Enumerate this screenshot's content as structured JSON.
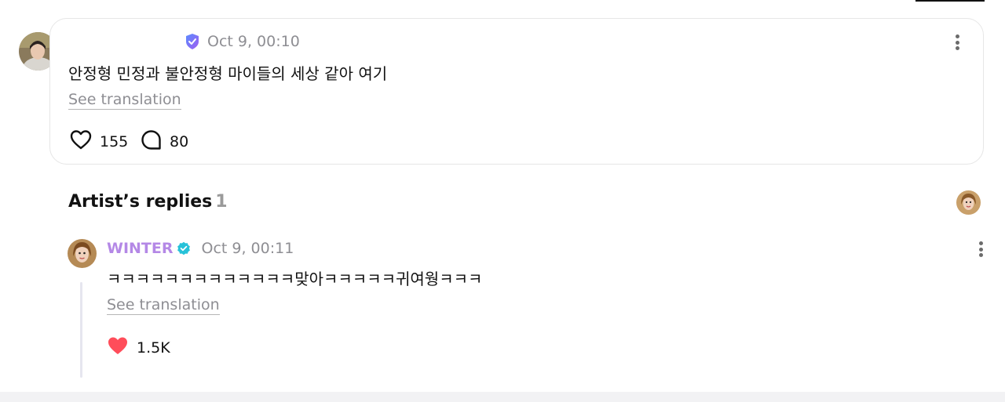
{
  "post": {
    "author_name": "",
    "timestamp": "Oct 9, 00:10",
    "text": "안정형 민정과 불안정형 마이들의 세상 같아 여기",
    "see_translation": "See translation",
    "likes": "155",
    "comments": "80",
    "badge_color": "#7b6cf6"
  },
  "artist_replies": {
    "title": "Artist’s replies",
    "count": "1"
  },
  "reply": {
    "author_name": "WINTER",
    "author_color": "#b488e6",
    "verified_color": "#27c2d9",
    "timestamp": "Oct 9, 00:11",
    "text": "ㅋㅋㅋㅋㅋㅋㅋㅋㅋㅋㅋㅋㅋ맞아ㅋㅋㅋㅋㅋ귀여웡ㅋㅋㅋ",
    "see_translation": "See translation",
    "likes": "1.5K",
    "like_color": "#ff4d5a"
  },
  "icons": {
    "verified": "verified-badge-icon",
    "heart": "heart-icon",
    "comment": "comment-bubble-icon",
    "more": "more-vertical-icon"
  }
}
